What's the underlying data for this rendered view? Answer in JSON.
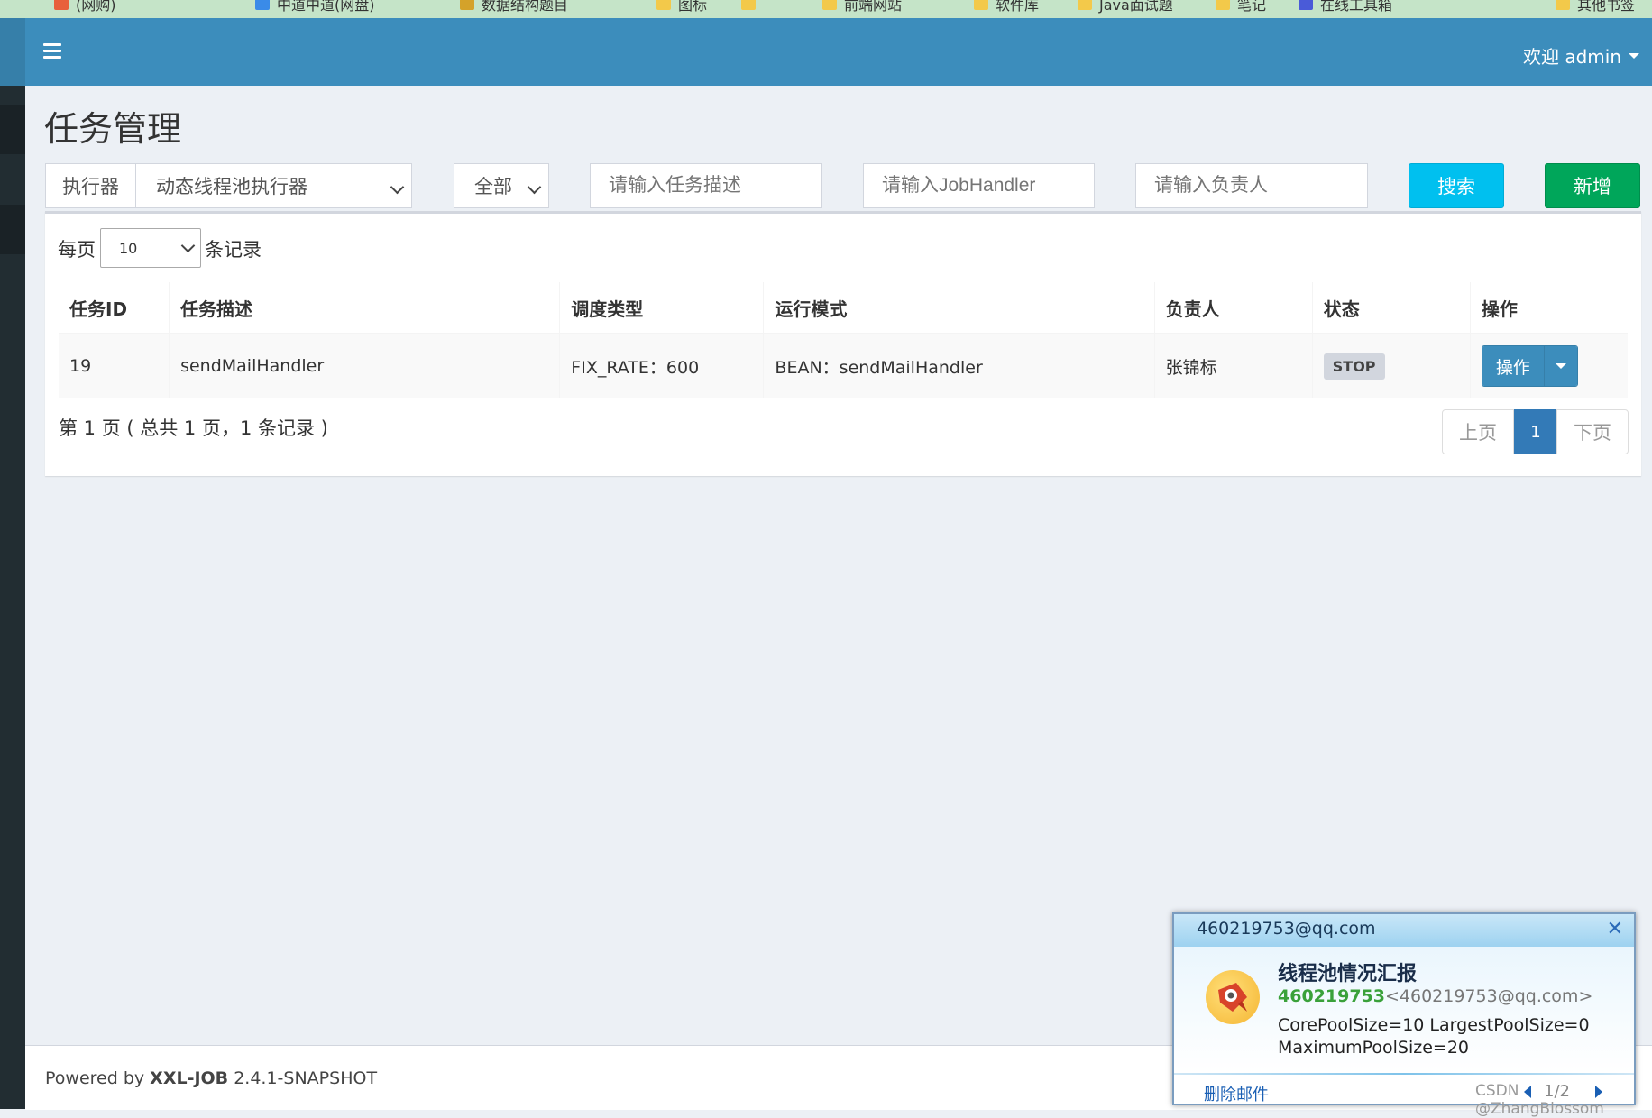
{
  "bookmarks": [
    {
      "label": "(网购)",
      "icon": "bookmark-icon",
      "color": "#e8603c"
    },
    {
      "label": "中道中道(网盘)",
      "icon": "bookmark-icon",
      "color": "#3a8be8"
    },
    {
      "label": "数据结构题目",
      "icon": "bookmark-icon",
      "color": "#d4a22a"
    },
    {
      "label": "图标",
      "icon": "folder-icon",
      "color": "#f3c94a"
    },
    {
      "label": "",
      "icon": "folder-icon",
      "color": "#f3c94a"
    },
    {
      "label": "前端网站",
      "icon": "folder-icon",
      "color": "#f3c94a"
    },
    {
      "label": "软件库",
      "icon": "folder-icon",
      "color": "#f3c94a"
    },
    {
      "label": "Java面试题",
      "icon": "folder-icon",
      "color": "#f3c94a"
    },
    {
      "label": "笔记",
      "icon": "folder-icon",
      "color": "#f3c94a"
    },
    {
      "label": "在线工具箱",
      "icon": "bookmark-icon",
      "color": "#4a5bd8"
    },
    {
      "label": "其他书签",
      "icon": "folder-icon",
      "color": "#f3c94a"
    }
  ],
  "header": {
    "user_menu": "欢迎 admin"
  },
  "page": {
    "title": "任务管理"
  },
  "filters": {
    "executor_addon": "执行器",
    "executor_value": "动态线程池执行器",
    "status_value": "全部",
    "desc_placeholder": "请输入任务描述",
    "handler_placeholder": "请输入JobHandler",
    "author_placeholder": "请输入负责人",
    "search_label": "搜索",
    "add_label": "新增"
  },
  "length": {
    "prefix": "每页",
    "value": "10",
    "suffix": "条记录"
  },
  "table": {
    "columns": [
      "任务ID",
      "任务描述",
      "调度类型",
      "运行模式",
      "负责人",
      "状态",
      "操作"
    ],
    "rows": [
      {
        "id": "19",
        "desc": "sendMailHandler",
        "schedule": "FIX_RATE：600",
        "mode": "BEAN：sendMailHandler",
        "author": "张锦标",
        "status": "STOP",
        "action": "操作"
      }
    ]
  },
  "pagination": {
    "info": "第 1 页 ( 总共 1 页，1 条记录 )",
    "prev": "上页",
    "current": "1",
    "next": "下页"
  },
  "footer": {
    "prefix": "Powered by ",
    "brand": "XXL-JOB",
    "version": " 2.4.1-SNAPSHOT"
  },
  "mail_popup": {
    "sender": "460219753@qq.com",
    "subject": "线程池情况汇报",
    "from_name": "460219753",
    "from_addr": "<460219753@qq.com>",
    "body_line1": "CorePoolSize=10 LargestPoolSize=0",
    "body_line2": "MaximumPoolSize=20",
    "delete_label": "删除邮件",
    "counter": "1/2"
  },
  "watermark": "CSDN @ZhangBlossom",
  "colors": {
    "primary": "#3c8dbc",
    "info": "#00c0ef",
    "success": "#00a65a",
    "sidebar": "#222d32"
  }
}
